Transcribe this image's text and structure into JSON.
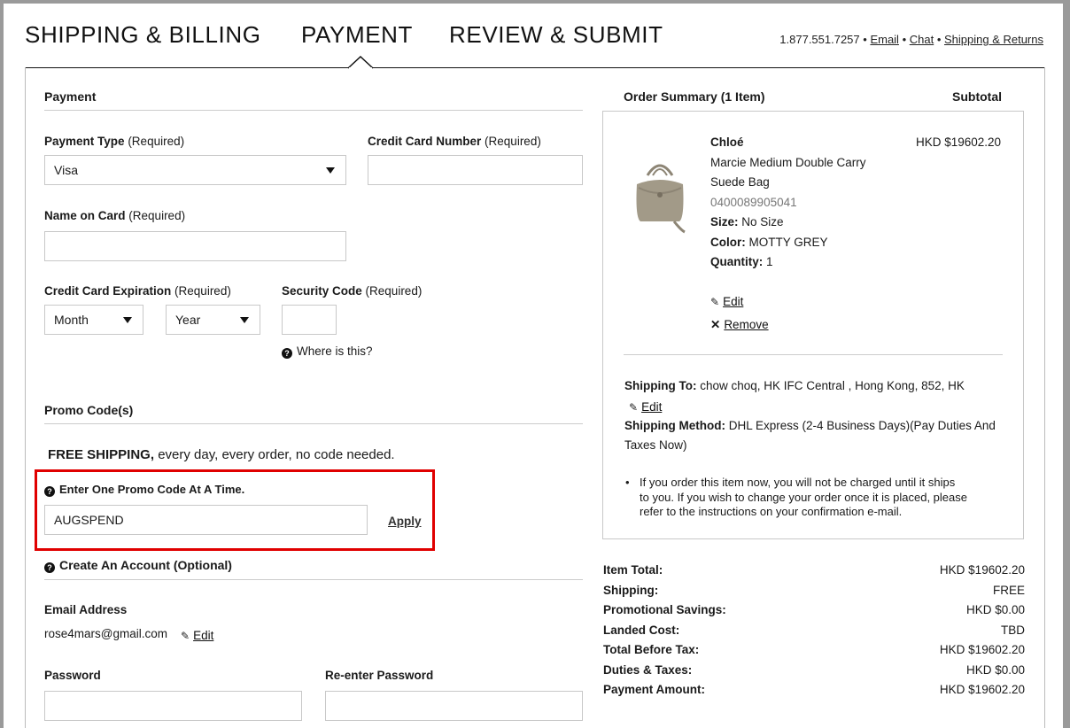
{
  "steps": {
    "shipping": "SHIPPING & BILLING",
    "payment": "PAYMENT",
    "review": "REVIEW & SUBMIT"
  },
  "contact": {
    "phone": "1.877.551.7257",
    "email": "Email",
    "chat": "Chat",
    "returns": "Shipping & Returns"
  },
  "payment": {
    "heading": "Payment",
    "payment_type_label": "Payment Type",
    "required": "(Required)",
    "payment_type_value": "Visa",
    "cc_number_label": "Credit Card Number",
    "name_label": "Name on Card",
    "expiration_label": "Credit Card Expiration",
    "month": "Month",
    "year": "Year",
    "security_label": "Security Code",
    "where": "Where is this?"
  },
  "promo": {
    "heading": "Promo Code(s)",
    "free_bold": "FREE SHIPPING,",
    "free_rest": " every day, every order, no code needed.",
    "enter_label": "Enter One Promo Code At A Time.",
    "code_value": "AUGSPEND",
    "apply": "Apply"
  },
  "account": {
    "heading": "Create An Account (Optional)",
    "email_label": "Email Address",
    "email_value": "rose4mars@gmail.com",
    "edit": "Edit",
    "password_label": "Password",
    "reenter_label": "Re-enter Password"
  },
  "summary": {
    "heading": "Order Summary (1 Item)",
    "subtotal": "Subtotal",
    "brand": "Chloé",
    "price": "HKD $19602.20",
    "name_line1": "Marcie Medium Double Carry",
    "name_line2": "Suede Bag",
    "sku": "0400089905041",
    "size_label": "Size:",
    "size_value": "No Size",
    "color_label": "Color:",
    "color_value": "MOTTY GREY",
    "qty_label": "Quantity:",
    "qty_value": "1",
    "edit": "Edit",
    "remove": "Remove",
    "ship_to_label": "Shipping To:",
    "ship_to_value": "chow choq, HK IFC Central , Hong Kong, 852, HK",
    "method_label": "Shipping Method:",
    "method_value_1": "DHL Express (2-4 Business Days)(Pay Duties And",
    "method_value_2": "Taxes Now)",
    "note_1": "If you order this item now, you will not be charged until it ships",
    "note_2": "to you. If you wish to change your order once it is placed, please",
    "note_3": "refer to the instructions on your confirmation e-mail."
  },
  "totals": [
    {
      "label": "Item Total:",
      "value": "HKD $19602.20"
    },
    {
      "label": "Shipping:",
      "value": "FREE"
    },
    {
      "label": "Promotional Savings:",
      "value": "HKD $0.00"
    },
    {
      "label": "Landed Cost:",
      "value": "TBD"
    },
    {
      "label": "Total Before Tax:",
      "value": "HKD $19602.20"
    },
    {
      "label": "Duties & Taxes:",
      "value": "HKD $0.00"
    },
    {
      "label": "Payment Amount:",
      "value": "HKD $19602.20"
    }
  ],
  "colors": {
    "highlight": "#e00000",
    "border": "#c8c8c8",
    "text": "#1a1a1a",
    "sku": "#777777"
  },
  "icons": [
    "question-circle-icon",
    "pencil-icon",
    "close-icon",
    "chevron-down-icon"
  ]
}
